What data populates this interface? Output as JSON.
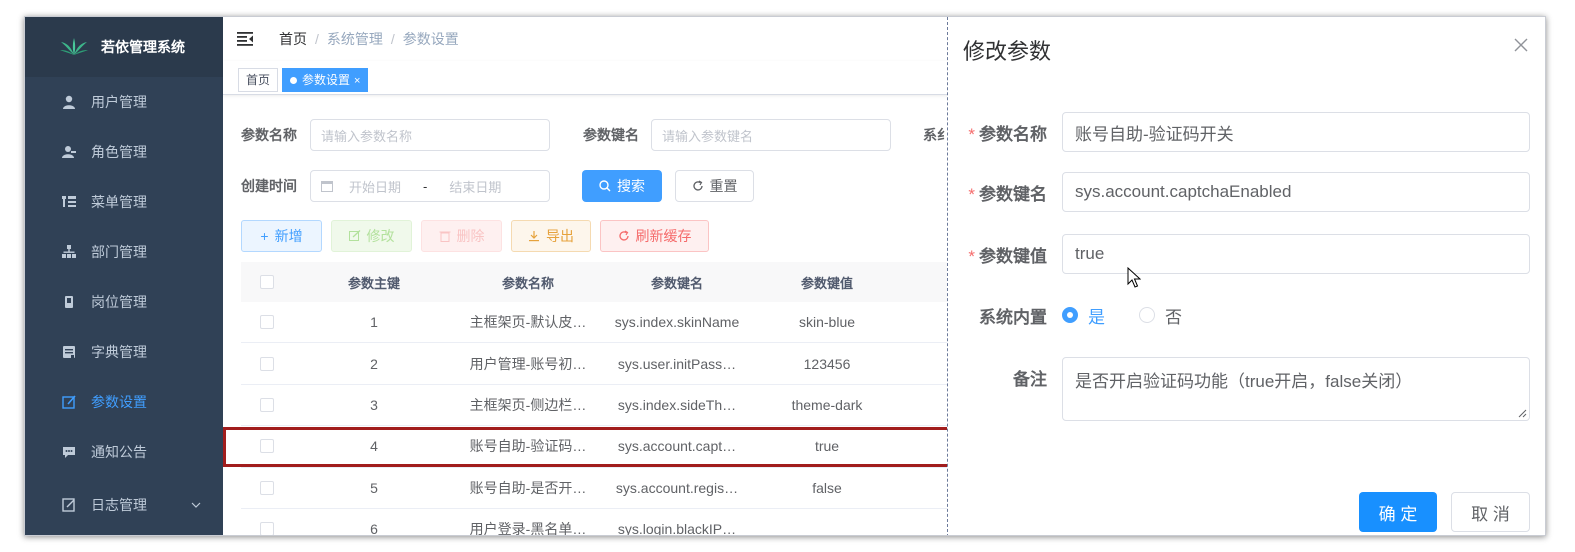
{
  "app": {
    "title": "若依管理系统"
  },
  "sidebar": {
    "items": [
      {
        "label": "用户管理",
        "icon": "user-icon"
      },
      {
        "label": "角色管理",
        "icon": "peoples-icon"
      },
      {
        "label": "菜单管理",
        "icon": "tree-table-icon"
      },
      {
        "label": "部门管理",
        "icon": "tree-icon"
      },
      {
        "label": "岗位管理",
        "icon": "post-icon"
      },
      {
        "label": "字典管理",
        "icon": "dict-icon"
      },
      {
        "label": "参数设置",
        "icon": "edit-icon",
        "active": true
      },
      {
        "label": "通知公告",
        "icon": "message-icon"
      },
      {
        "label": "日志管理",
        "icon": "log-icon",
        "expandable": true
      }
    ]
  },
  "breadcrumb": {
    "home": "首页",
    "level1": "系统管理",
    "level2": "参数设置"
  },
  "tags": {
    "home": "首页",
    "active": "参数设置"
  },
  "search": {
    "name_label": "参数名称",
    "name_placeholder": "请输入参数名称",
    "key_label": "参数键名",
    "key_placeholder": "请输入参数键名",
    "type_label_partial": "系纟",
    "time_label": "创建时间",
    "start_placeholder": "开始日期",
    "range_sep": "-",
    "end_placeholder": "结束日期",
    "search_btn": "搜索",
    "reset_btn": "重置"
  },
  "toolbar": {
    "add": "新增",
    "edit": "修改",
    "delete": "删除",
    "export": "导出",
    "refresh": "刷新缓存"
  },
  "table": {
    "headers": [
      "参数主键",
      "参数名称",
      "参数键名",
      "参数键值"
    ],
    "rows": [
      [
        "1",
        "主框架页-默认皮…",
        "sys.index.skinName",
        "skin-blue"
      ],
      [
        "2",
        "用户管理-账号初…",
        "sys.user.initPass…",
        "123456"
      ],
      [
        "3",
        "主框架页-侧边栏…",
        "sys.index.sideTh…",
        "theme-dark"
      ],
      [
        "4",
        "账号自助-验证码…",
        "sys.account.capt…",
        "true"
      ],
      [
        "5",
        "账号自助-是否开…",
        "sys.account.regis…",
        "false"
      ],
      [
        "6",
        "用户登录-黑名单…",
        "sys.login.blackIP…",
        ""
      ]
    ]
  },
  "drawer": {
    "title": "修改参数",
    "name_label": "参数名称",
    "name_value": "账号自助-验证码开关",
    "key_label": "参数键名",
    "key_value": "sys.account.captchaEnabled",
    "value_label": "参数键值",
    "value_value": "true",
    "builtin_label": "系统内置",
    "yes": "是",
    "no": "否",
    "remark_label": "备注",
    "remark_value": "是否开启验证码功能（true开启，false关闭）",
    "confirm": "确 定",
    "cancel": "取 消"
  },
  "colors": {
    "sidebar": "#304156",
    "primary": "#409eff",
    "highlight": "#a11d1d"
  }
}
